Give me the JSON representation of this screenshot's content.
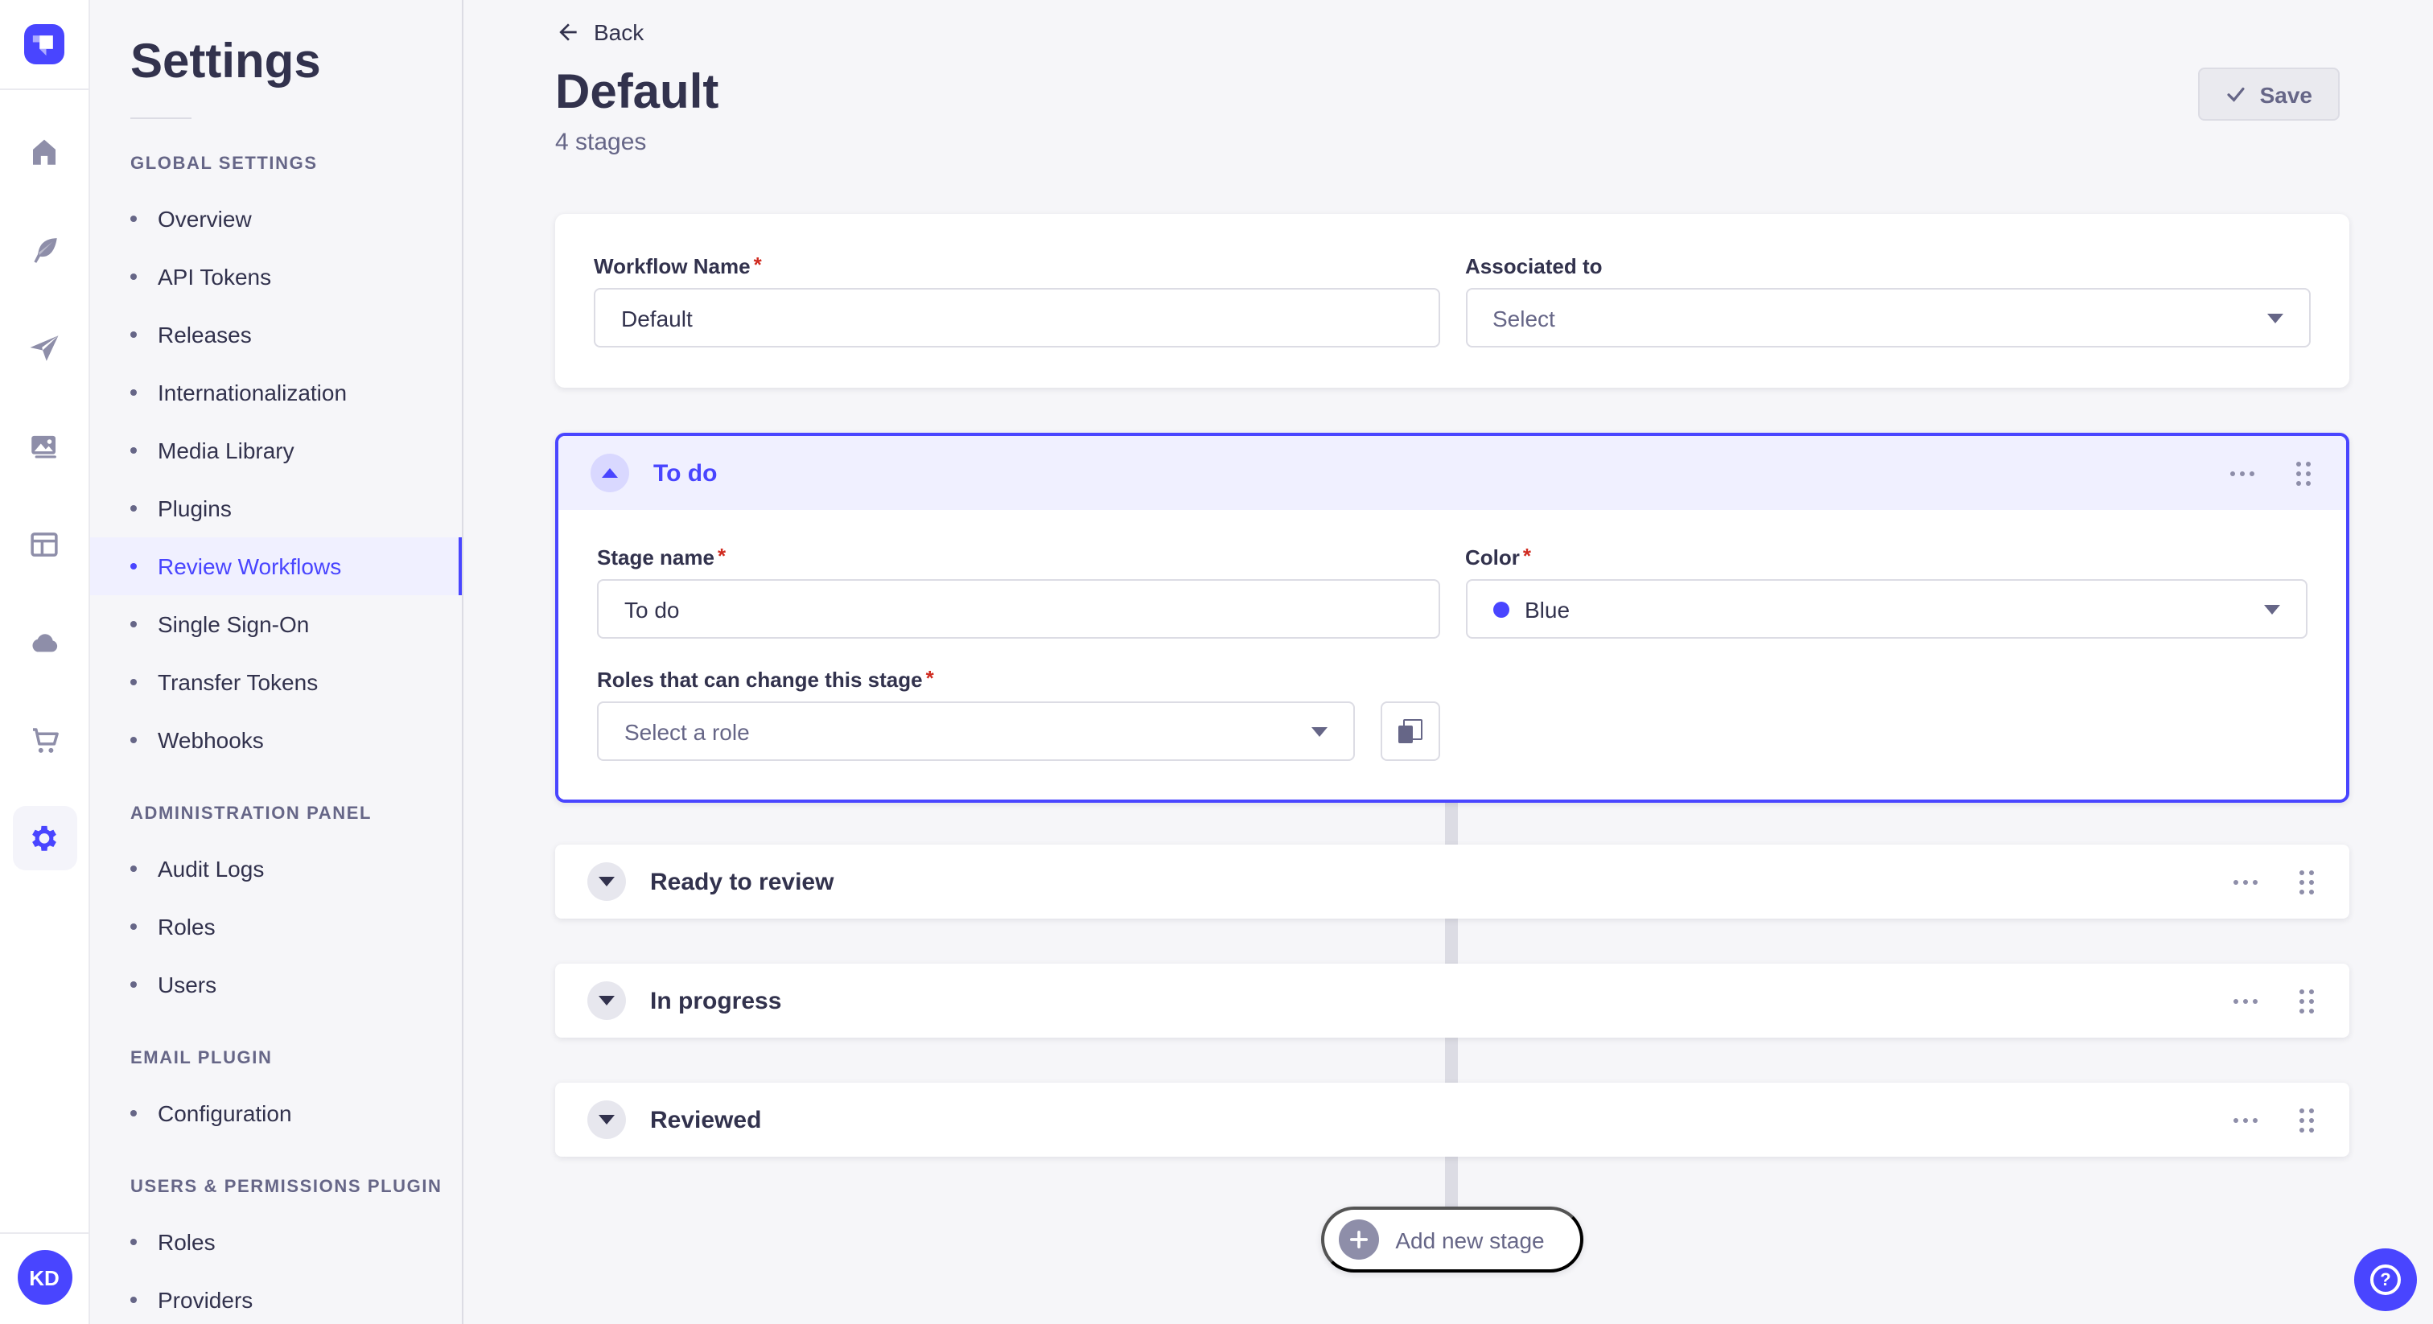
{
  "colors": {
    "primary": "#4945ff",
    "primary_light": "#f0f0ff",
    "required_red": "#d02b20",
    "connector_gray": "#dcdce4",
    "app_background": "#f6f6f9"
  },
  "ui": {
    "required_mark": "*",
    "help_glyph": "?"
  },
  "user": {
    "initials": "KD"
  },
  "rail": {
    "icons": [
      "strapi-logo",
      "home",
      "feather-pen",
      "paper-plane",
      "pictures",
      "layout",
      "cloud",
      "shopping-cart",
      "gear"
    ],
    "active_icon": "gear"
  },
  "sidebar": {
    "title": "Settings",
    "sections": [
      {
        "label": "GLOBAL SETTINGS",
        "active_item": "Review Workflows",
        "items": [
          "Overview",
          "API Tokens",
          "Releases",
          "Internationalization",
          "Media Library",
          "Plugins",
          "Review Workflows",
          "Single Sign-On",
          "Transfer Tokens",
          "Webhooks"
        ]
      },
      {
        "label": "ADMINISTRATION PANEL",
        "items": [
          "Audit Logs",
          "Roles",
          "Users"
        ]
      },
      {
        "label": "EMAIL PLUGIN",
        "items": [
          "Configuration"
        ]
      },
      {
        "label": "USERS & PERMISSIONS PLUGIN",
        "items": [
          "Roles",
          "Providers"
        ]
      }
    ]
  },
  "header": {
    "back_label": "Back",
    "title": "Default",
    "subtitle": "4 stages",
    "save_label": "Save"
  },
  "workflow_form": {
    "workflow_name": {
      "label": "Workflow Name",
      "required": true,
      "value": "Default"
    },
    "associated_to": {
      "label": "Associated to",
      "required": false,
      "placeholder": "Select"
    }
  },
  "stages": [
    {
      "name": "To do",
      "expanded": true,
      "stage_name": {
        "label": "Stage name",
        "required": true,
        "value": "To do"
      },
      "color": {
        "label": "Color",
        "required": true,
        "value": "Blue",
        "swatch": "#4945ff"
      },
      "roles": {
        "label": "Roles that can change this stage",
        "required": true,
        "placeholder": "Select a role"
      }
    },
    {
      "name": "Ready to review",
      "expanded": false
    },
    {
      "name": "In progress",
      "expanded": false
    },
    {
      "name": "Reviewed",
      "expanded": false
    }
  ],
  "add_stage_label": "Add new stage"
}
